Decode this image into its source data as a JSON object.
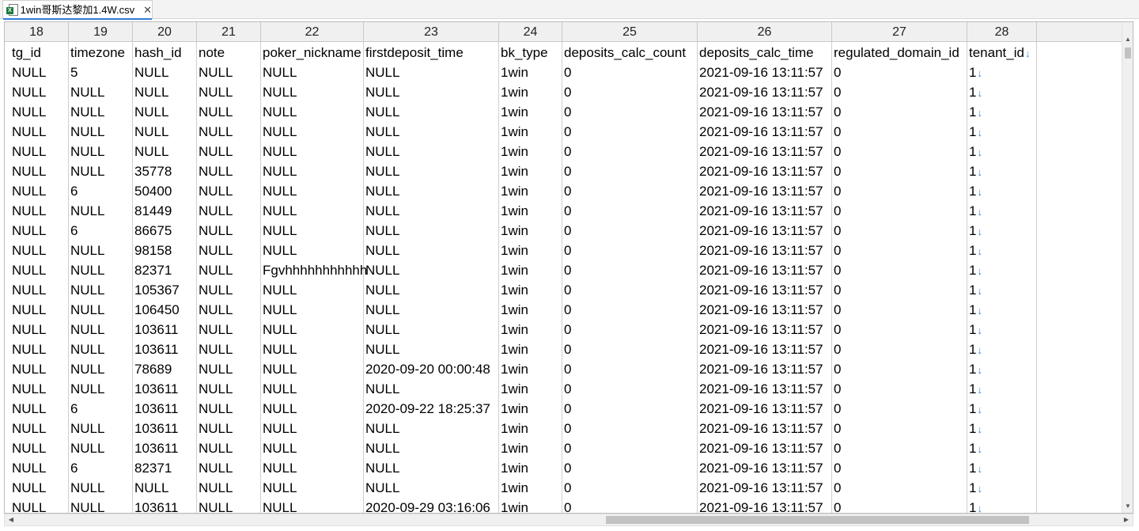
{
  "tab": {
    "title": "1win哥斯达黎加1.4W.csv",
    "close": "✕"
  },
  "column_numbers": [
    "18",
    "19",
    "20",
    "21",
    "22",
    "23",
    "24",
    "25",
    "26",
    "27",
    "28"
  ],
  "header_row": [
    "tg_id",
    "timezone",
    "hash_id",
    "note",
    "poker_nickname",
    "firstdeposit_time",
    "bk_type",
    "deposits_calc_count",
    "deposits_calc_time",
    "regulated_domain_id",
    "tenant_id"
  ],
  "rows": [
    [
      "NULL",
      "5",
      "NULL",
      "NULL",
      "NULL",
      "NULL",
      "1win",
      "0",
      "2021-09-16 13:11:57",
      "0",
      "1"
    ],
    [
      "NULL",
      "NULL",
      "NULL",
      "NULL",
      "NULL",
      "NULL",
      "1win",
      "0",
      "2021-09-16 13:11:57",
      "0",
      "1"
    ],
    [
      "NULL",
      "NULL",
      "NULL",
      "NULL",
      "NULL",
      "NULL",
      "1win",
      "0",
      "2021-09-16 13:11:57",
      "0",
      "1"
    ],
    [
      "NULL",
      "NULL",
      "NULL",
      "NULL",
      "NULL",
      "NULL",
      "1win",
      "0",
      "2021-09-16 13:11:57",
      "0",
      "1"
    ],
    [
      "NULL",
      "NULL",
      "NULL",
      "NULL",
      "NULL",
      "NULL",
      "1win",
      "0",
      "2021-09-16 13:11:57",
      "0",
      "1"
    ],
    [
      "NULL",
      "NULL",
      "35778",
      "NULL",
      "NULL",
      "NULL",
      "1win",
      "0",
      "2021-09-16 13:11:57",
      "0",
      "1"
    ],
    [
      "NULL",
      "6",
      "50400",
      "NULL",
      "NULL",
      "NULL",
      "1win",
      "0",
      "2021-09-16 13:11:57",
      "0",
      "1"
    ],
    [
      "NULL",
      "NULL",
      "81449",
      "NULL",
      "NULL",
      "NULL",
      "1win",
      "0",
      "2021-09-16 13:11:57",
      "0",
      "1"
    ],
    [
      "NULL",
      "6",
      "86675",
      "NULL",
      "NULL",
      "NULL",
      "1win",
      "0",
      "2021-09-16 13:11:57",
      "0",
      "1"
    ],
    [
      "NULL",
      "NULL",
      "98158",
      "NULL",
      "NULL",
      "NULL",
      "1win",
      "0",
      "2021-09-16 13:11:57",
      "0",
      "1"
    ],
    [
      "NULL",
      "NULL",
      "82371",
      "NULL",
      "Fgvhhhhhhhhhhh",
      "NULL",
      "1win",
      "0",
      "2021-09-16 13:11:57",
      "0",
      "1"
    ],
    [
      "NULL",
      "NULL",
      "105367",
      "NULL",
      "NULL",
      "NULL",
      "1win",
      "0",
      "2021-09-16 13:11:57",
      "0",
      "1"
    ],
    [
      "NULL",
      "NULL",
      "106450",
      "NULL",
      "NULL",
      "NULL",
      "1win",
      "0",
      "2021-09-16 13:11:57",
      "0",
      "1"
    ],
    [
      "NULL",
      "NULL",
      "103611",
      "NULL",
      "NULL",
      "NULL",
      "1win",
      "0",
      "2021-09-16 13:11:57",
      "0",
      "1"
    ],
    [
      "NULL",
      "NULL",
      "103611",
      "NULL",
      "NULL",
      "NULL",
      "1win",
      "0",
      "2021-09-16 13:11:57",
      "0",
      "1"
    ],
    [
      "NULL",
      "NULL",
      "78689",
      "NULL",
      "NULL",
      "2020-09-20 00:00:48",
      "1win",
      "0",
      "2021-09-16 13:11:57",
      "0",
      "1"
    ],
    [
      "NULL",
      "NULL",
      "103611",
      "NULL",
      "NULL",
      "NULL",
      "1win",
      "0",
      "2021-09-16 13:11:57",
      "0",
      "1"
    ],
    [
      "NULL",
      "6",
      "103611",
      "NULL",
      "NULL",
      "2020-09-22 18:25:37",
      "1win",
      "0",
      "2021-09-16 13:11:57",
      "0",
      "1"
    ],
    [
      "NULL",
      "NULL",
      "103611",
      "NULL",
      "NULL",
      "NULL",
      "1win",
      "0",
      "2021-09-16 13:11:57",
      "0",
      "1"
    ],
    [
      "NULL",
      "NULL",
      "103611",
      "NULL",
      "NULL",
      "NULL",
      "1win",
      "0",
      "2021-09-16 13:11:57",
      "0",
      "1"
    ],
    [
      "NULL",
      "6",
      "82371",
      "NULL",
      "NULL",
      "NULL",
      "1win",
      "0",
      "2021-09-16 13:11:57",
      "0",
      "1"
    ],
    [
      "NULL",
      "NULL",
      "NULL",
      "NULL",
      "NULL",
      "NULL",
      "1win",
      "0",
      "2021-09-16 13:11:57",
      "0",
      "1"
    ],
    [
      "NULL",
      "NULL",
      "103611",
      "NULL",
      "NULL",
      "2020-09-29 03:16:06",
      "1win",
      "0",
      "2021-09-16 13:11:57",
      "0",
      "1"
    ]
  ],
  "icons": {
    "file": "excel-csv-file-icon",
    "wrap": "line-wrap-arrow-icon"
  },
  "colors": {
    "accent": "#2f7bd6",
    "arrow": "#3b86d8",
    "excel_green": "#1d7a3e"
  }
}
